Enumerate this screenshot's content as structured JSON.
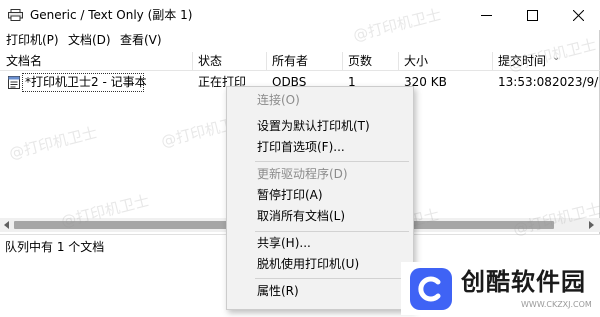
{
  "window": {
    "title": "Generic / Text Only (副本 1)",
    "minimize_icon": "minimize-icon",
    "maximize_icon": "maximize-icon",
    "close_icon": "close-icon"
  },
  "menu": {
    "items": [
      "打印机(P)",
      "文档(D)",
      "查看(V)"
    ]
  },
  "columns": [
    "文档名",
    "状态",
    "所有者",
    "页数",
    "大小",
    "提交时间"
  ],
  "rows": [
    {
      "document": "*打印机卫士2 - 记事本",
      "status": "正在打印",
      "owner": "ODBS",
      "pages": "1",
      "size": "320 KB",
      "time": "13:53:08",
      "date": "2023/9/"
    }
  ],
  "status_bar": {
    "text": "队列中有 1 个文档"
  },
  "context_menu": {
    "items": [
      {
        "label": "连接(O)",
        "disabled": true
      },
      {
        "label": "设置为默认打印机(T)",
        "disabled": false
      },
      {
        "label": "打印首选项(F)...",
        "disabled": false
      },
      {
        "label": "更新驱动程序(D)",
        "disabled": true
      },
      {
        "label": "暂停打印(A)",
        "disabled": false
      },
      {
        "label": "取消所有文档(L)",
        "disabled": false
      },
      {
        "label": "共享(H)...",
        "disabled": false
      },
      {
        "label": "脱机使用打印机(U)",
        "disabled": false
      },
      {
        "label": "属性(R)",
        "disabled": false
      }
    ]
  },
  "watermark": {
    "text": "@打印机卫士"
  },
  "brand": {
    "name": "创酷软件园",
    "url": "WWW.CKZXJ.COM",
    "accent_color": "#3f63f5"
  }
}
